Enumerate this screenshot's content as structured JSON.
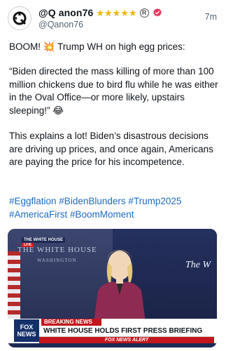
{
  "post": {
    "display_name": "@Q anon76",
    "handle": "@Qanon76",
    "timestamp": "7m",
    "badges": {
      "stars": 5,
      "registered": "R",
      "verified_color": "#e8365d"
    },
    "paragraphs": [
      "BOOM! 💥 Trump WH on high egg prices:",
      "“Biden directed the mass killing of more than 100 million chickens due to bird flu while he was either in the Oval Office—or more likely, upstairs sleeping!” 😂",
      "This explains a lot! Biden’s disastrous decisions are driving up prices, and once again, Americans are paying the price for his incompetence.",
      "#Eggflation #BidenBlunders #Trump2025 #AmericaFirst #BoomMoment"
    ],
    "hashtag_color": "#1d6bc4"
  },
  "media": {
    "backdrop_left": "THE WHITE HOUSE",
    "backdrop_left_sub": "WASHINGTON",
    "backdrop_right": "The W",
    "live_tag": "THE WHITE HOUSE",
    "live_sub": "LIVE",
    "network_logo": "FOX NEWS",
    "breaking_label": "BREAKING NEWS",
    "headline": "WHITE HOUSE HOLDS FIRST PRESS BRIEFING",
    "alert_label": "FOX NEWS ALERT"
  }
}
